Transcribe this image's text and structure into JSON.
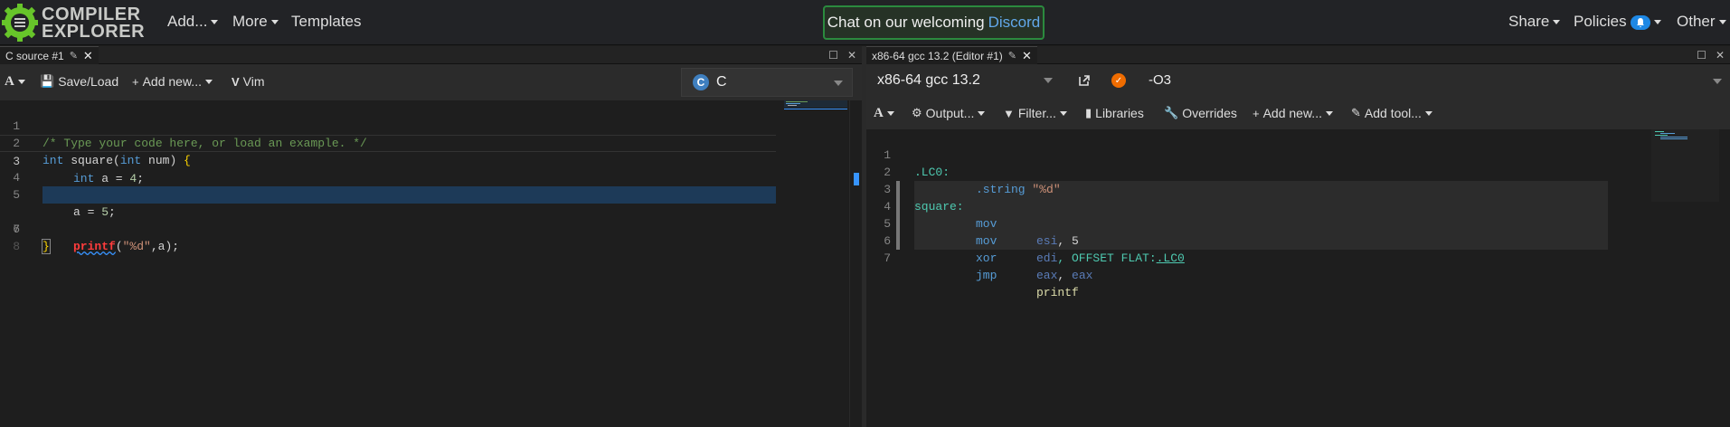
{
  "navbar": {
    "logo_line1": "COMPILER",
    "logo_line2": "EXPLORER",
    "add": "Add...",
    "more": "More",
    "templates": "Templates",
    "discord_prefix": "Chat on our welcoming",
    "discord_link": "Discord",
    "share": "Share",
    "policies": "Policies",
    "other": "Other"
  },
  "left_pane": {
    "tab_title": "C source #1",
    "toolbar": {
      "font_label": "A",
      "save_load": "Save/Load",
      "add_new": "Add new...",
      "vim": "Vim"
    },
    "language": "C",
    "lines": [
      {
        "n": "1"
      },
      {
        "n": "2"
      },
      {
        "n": "3"
      },
      {
        "n": "4"
      },
      {
        "n": "5"
      },
      {
        "n": "6"
      },
      {
        "n": "7"
      },
      {
        "n": "8"
      }
    ],
    "code": {
      "l1": "/* Type your code here, or load an example. */",
      "l2_kw": "int",
      "l2_fn": " square(",
      "l2_kw2": "int",
      "l2_rest": " num) ",
      "l2_brace": "{",
      "l3_kw": "int",
      "l3_rest": " a = ",
      "l3_num": "4",
      "l3_end": ";",
      "l5_rest": "a = ",
      "l5_num": "5",
      "l5_end": ";",
      "l6_fn": "printf",
      "l6_open": "(",
      "l6_str": "\"%d\"",
      "l6_rest": ",a);",
      "l7_brace": "}"
    }
  },
  "right_pane": {
    "tab_title": "x86-64 gcc 13.2 (Editor #1)",
    "compiler": "x86-64 gcc 13.2",
    "options": "-O3",
    "toolbar": {
      "font_label": "A",
      "output": "Output...",
      "filter": "Filter...",
      "libraries": "Libraries",
      "overrides": "Overrides",
      "add_new": "Add new...",
      "add_tool": "Add tool..."
    },
    "asm": {
      "l1": ".LC0:",
      "l2_dir": ".string",
      "l2_str": "\"%d\"",
      "l3": "square:",
      "l4_ins": "mov",
      "l4_reg": "esi",
      "l4_rest": ", 5",
      "l5_ins": "mov",
      "l5_reg": "edi",
      "l5_rest": ", OFFSET FLAT:",
      "l5_link": ".LC0",
      "l6_ins": "xor",
      "l6_reg1": "eax",
      "l6_sep": ", ",
      "l6_reg2": "eax",
      "l7_ins": "jmp",
      "l7_sym": "printf"
    },
    "line_numbers": [
      "1",
      "2",
      "3",
      "4",
      "5",
      "6",
      "7"
    ]
  }
}
